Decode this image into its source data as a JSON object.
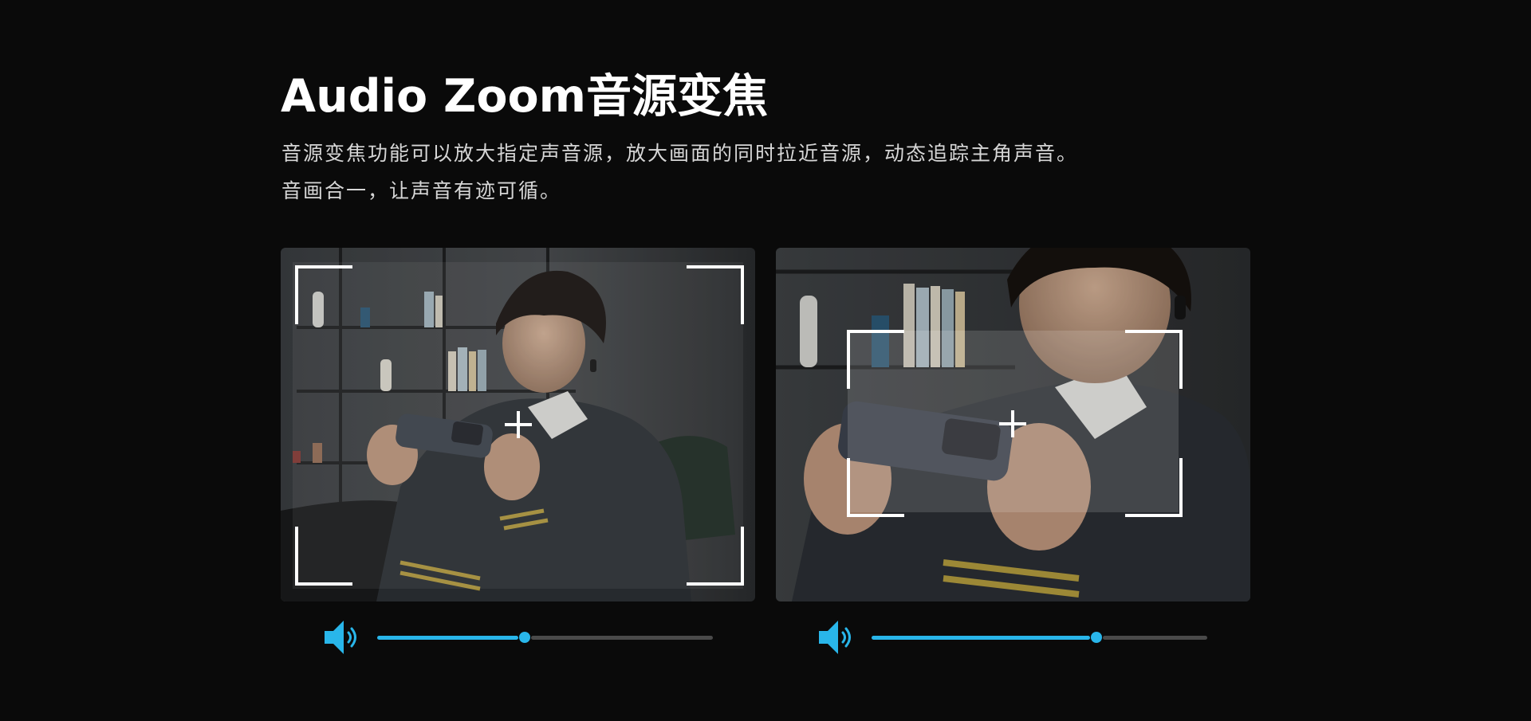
{
  "header": {
    "title": "Audio Zoom音源变焦",
    "description_line1": "音源变焦功能可以放大指定声音源，放大画面的同时拉近音源，动态追踪主角声音。",
    "description_line2": "音画合一，让声音有迹可循。"
  },
  "panels": [
    {
      "name": "wide-view",
      "volume_fraction": 0.44,
      "icon": "speaker-volume-icon"
    },
    {
      "name": "zoomed-view",
      "volume_fraction": 0.67,
      "icon": "speaker-volume-icon"
    }
  ],
  "colors": {
    "background": "#0a0a0a",
    "accent": "#29b6ea",
    "track": "#4a4a4a",
    "text": "#ffffff",
    "subtext": "#d6d6d6"
  }
}
